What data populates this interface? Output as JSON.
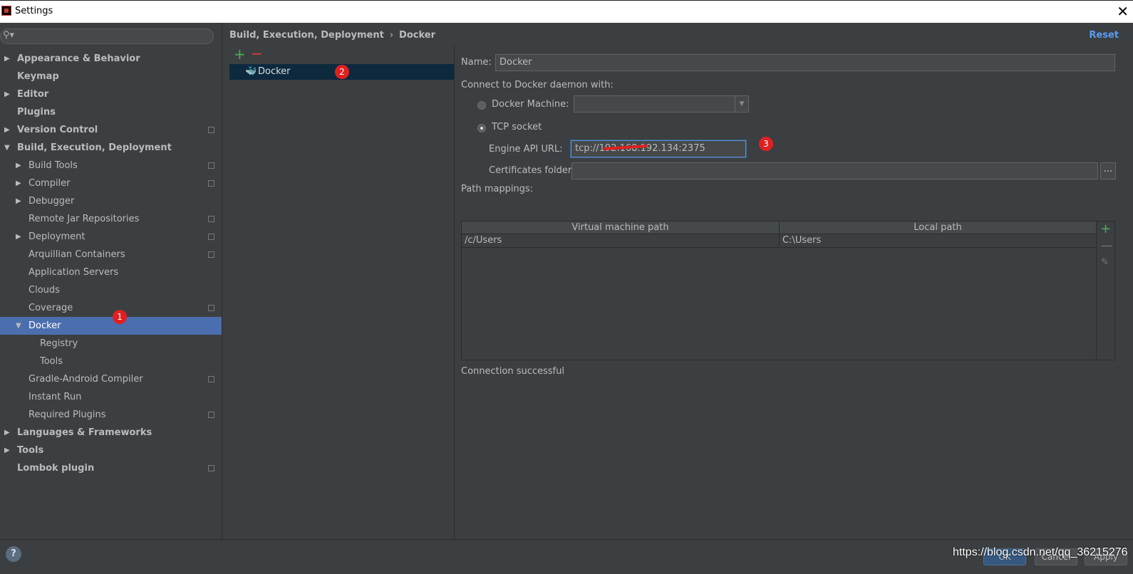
{
  "window": {
    "title": "Settings",
    "close_label": "✕"
  },
  "sidebar": {
    "search_icon": "⚲▾",
    "items": [
      {
        "label": "Appearance & Behavior",
        "level": 0,
        "arrow": "▶",
        "proj": false
      },
      {
        "label": "Keymap",
        "level": 0,
        "arrow": "",
        "proj": false
      },
      {
        "label": "Editor",
        "level": 0,
        "arrow": "▶",
        "proj": false
      },
      {
        "label": "Plugins",
        "level": 0,
        "arrow": "",
        "proj": false
      },
      {
        "label": "Version Control",
        "level": 0,
        "arrow": "▶",
        "proj": true
      },
      {
        "label": "Build, Execution, Deployment",
        "level": 0,
        "arrow": "▼",
        "proj": false
      },
      {
        "label": "Build Tools",
        "level": 1,
        "arrow": "▶",
        "proj": true
      },
      {
        "label": "Compiler",
        "level": 1,
        "arrow": "▶",
        "proj": true
      },
      {
        "label": "Debugger",
        "level": 1,
        "arrow": "▶",
        "proj": false
      },
      {
        "label": "Remote Jar Repositories",
        "level": 1,
        "arrow": "",
        "proj": true
      },
      {
        "label": "Deployment",
        "level": 1,
        "arrow": "▶",
        "proj": true
      },
      {
        "label": "Arquillian Containers",
        "level": 1,
        "arrow": "",
        "proj": true
      },
      {
        "label": "Application Servers",
        "level": 1,
        "arrow": "",
        "proj": false
      },
      {
        "label": "Clouds",
        "level": 1,
        "arrow": "",
        "proj": false
      },
      {
        "label": "Coverage",
        "level": 1,
        "arrow": "",
        "proj": true
      },
      {
        "label": "Docker",
        "level": 1,
        "arrow": "▼",
        "proj": false,
        "selected": true
      },
      {
        "label": "Registry",
        "level": 2,
        "arrow": "",
        "proj": false
      },
      {
        "label": "Tools",
        "level": 2,
        "arrow": "",
        "proj": false
      },
      {
        "label": "Gradle-Android Compiler",
        "level": 1,
        "arrow": "",
        "proj": true
      },
      {
        "label": "Instant Run",
        "level": 1,
        "arrow": "",
        "proj": false
      },
      {
        "label": "Required Plugins",
        "level": 1,
        "arrow": "",
        "proj": true
      },
      {
        "label": "Languages & Frameworks",
        "level": 0,
        "arrow": "▶",
        "proj": false
      },
      {
        "label": "Tools",
        "level": 0,
        "arrow": "▶",
        "proj": false
      },
      {
        "label": "Lombok plugin",
        "level": 0,
        "arrow": "",
        "proj": true
      }
    ]
  },
  "annotations": {
    "badge1": "1",
    "badge2": "2",
    "badge3": "3"
  },
  "header": {
    "crumb_parent": "Build, Execution, Deployment",
    "crumb_sep": "›",
    "crumb_current": "Docker",
    "reset_label": "Reset"
  },
  "docker_list": {
    "add_icon": "+",
    "remove_icon": "−",
    "items": [
      {
        "label": "Docker",
        "icon": "docker-whale-icon"
      }
    ]
  },
  "form": {
    "name_label": "Name:",
    "name_value": "Docker",
    "connect_label": "Connect to Docker daemon with:",
    "docker_machine_label": "Docker Machine:",
    "docker_machine_value": "",
    "tcp_label": "TCP socket",
    "engine_url_label": "Engine API URL:",
    "engine_url_value": "tcp://192.168.192.134:2375",
    "certs_label": "Certificates folder:",
    "certs_value": "",
    "browse_label": "...",
    "path_mappings_label": "Path mappings:",
    "columns": [
      "Virtual machine path",
      "Local path"
    ],
    "rows": [
      [
        "/c/Users",
        "C:\\Users"
      ]
    ],
    "status": "Connection successful"
  },
  "footer": {
    "help_label": "?",
    "ok_label": "OK",
    "cancel_label": "Cancel",
    "apply_label": "Apply",
    "watermark": "https://blog.csdn.net/qq_36215276"
  },
  "colors": {
    "accent": "#4b6eaf",
    "link": "#589df6",
    "badge": "#e02020",
    "bg": "#3c3f41"
  }
}
